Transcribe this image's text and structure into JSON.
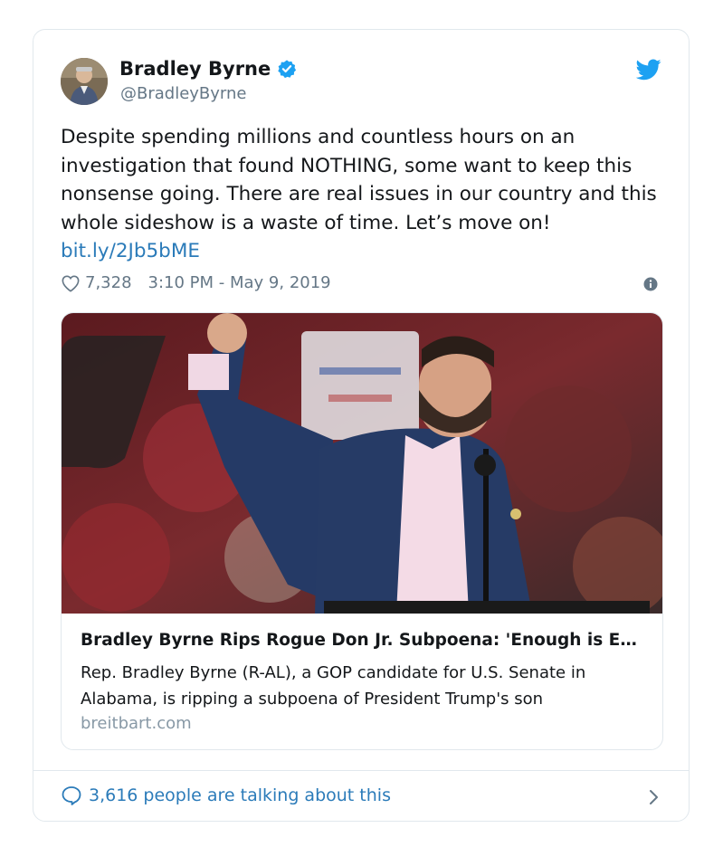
{
  "author": {
    "name": "Bradley Byrne",
    "handle": "@BradleyByrne"
  },
  "tweet": {
    "text": "Despite spending millions and countless hours on an investigation that found NOTHING, some want to keep this nonsense going. There are real issues in our country and this whole sideshow is a waste of time. Let’s move on! ",
    "link": "bit.ly/2Jb5bME",
    "likes": "7,328",
    "timestamp": "3:10 PM - May 9, 2019"
  },
  "card": {
    "title": "Bradley Byrne Rips Rogue Don Jr. Subpoena: 'Enough is Enough'",
    "description": "Rep. Bradley Byrne (R-AL), a GOP candidate for U.S. Senate in Alabama, is ripping a subpoena of President Trump's son",
    "domain": "breitbart.com"
  },
  "footer": {
    "talking": "3,616 people are talking about this"
  },
  "icons": [
    "verified-badge-icon",
    "twitter-bird-icon",
    "heart-icon",
    "info-icon",
    "chat-bubble-icon",
    "chevron-right-icon"
  ],
  "colors": {
    "link": "#2b7bb9",
    "verified": "#1da1f2",
    "muted": "#657786",
    "border": "#e1e8ed"
  }
}
